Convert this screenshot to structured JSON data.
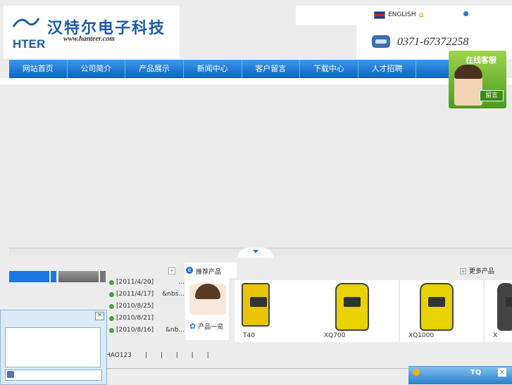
{
  "header": {
    "logo_abbr": "HTER",
    "company_name": "汉特尔电子科技",
    "website": "www.hanteer.com",
    "language_link": "ENGLISH",
    "phone_area": "0371-",
    "phone_number": "67372258"
  },
  "nav": {
    "items": [
      "网站首页",
      "公司简介",
      "产品展示",
      "新闻中心",
      "客户留言",
      "下载中心",
      "人才招聘",
      ""
    ]
  },
  "online_service": {
    "title": "在线客服",
    "message_label": "留言"
  },
  "news": {
    "items": [
      {
        "date": "[2011/4/20]",
        "tail": "..."
      },
      {
        "date": "[2011/4/17]",
        "tail": "&nbs..."
      },
      {
        "date": "[2010/8/25]",
        "tail": ""
      },
      {
        "date": "[2010/8/21]",
        "tail": ""
      },
      {
        "date": "[2010/8/16]",
        "tail": "&nb..."
      }
    ]
  },
  "products": {
    "section_title": "推荐产品",
    "more_label": "更多产品",
    "catalog_label": "产品一览",
    "items": [
      {
        "name": "T40"
      },
      {
        "name": "XQ700"
      },
      {
        "name": "XQ1000"
      },
      {
        "name": "X"
      }
    ]
  },
  "links": {
    "items": [
      "HAO123",
      "|",
      "|",
      "|",
      "|",
      "|"
    ]
  },
  "chat": {
    "close_label": "×"
  },
  "tq": {
    "label": "TQ",
    "close_label": "×"
  }
}
